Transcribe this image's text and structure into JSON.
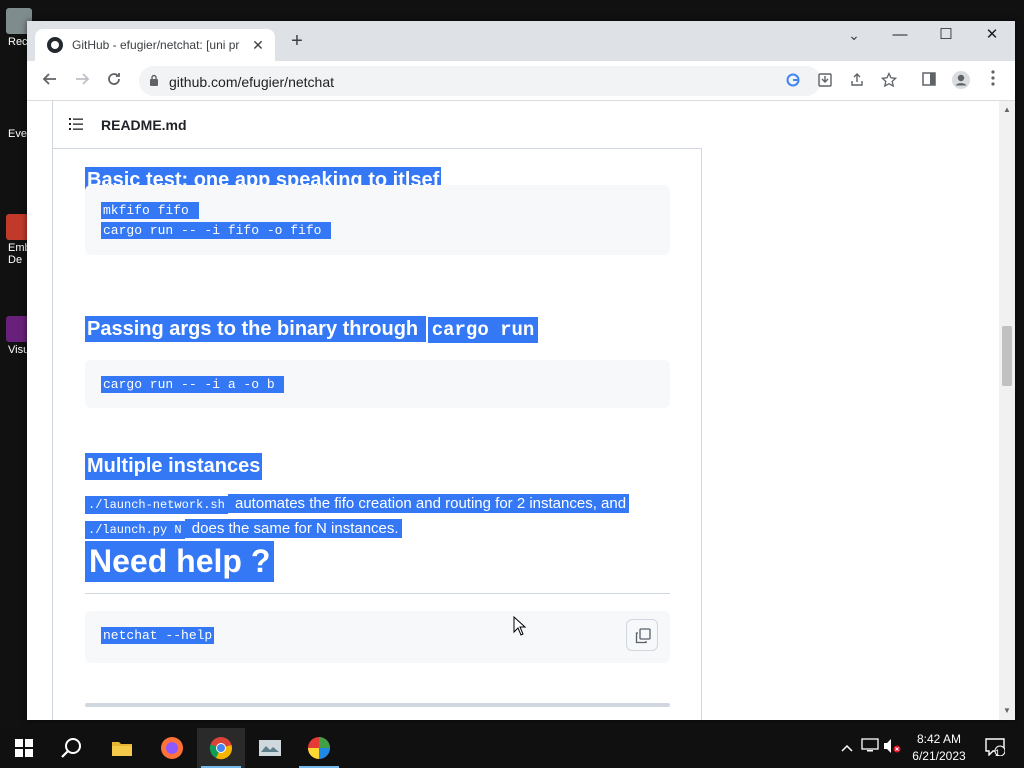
{
  "desktop": {
    "icons": [
      {
        "label": "Rec"
      },
      {
        "label": "Eve"
      },
      {
        "label": "Emb"
      },
      {
        "label": "De"
      },
      {
        "label": "Visu"
      }
    ]
  },
  "browser": {
    "tab": {
      "title": "GitHub - efugier/netchat: [uni pr",
      "close": "✕"
    },
    "new_tab": "+",
    "address": "github.com/efugier/netchat",
    "window_controls": {
      "tab_search": "⌄",
      "minimize": "—",
      "maximize": "☐",
      "close": "✕"
    }
  },
  "readme": {
    "filename": "README.md",
    "sections": {
      "basic_test": {
        "heading": "Basic test: one app speaking to itlsef",
        "code": [
          "mkfifo fifo ",
          "cargo run -- -i fifo -o fifo "
        ]
      },
      "passing_args": {
        "heading": "Passing args to the binary through ",
        "heading_code": "cargo run ",
        "code": [
          "cargo run -- -i a -o b "
        ]
      },
      "multiple": {
        "heading": "Multiple instances ",
        "code1": "./launch-network.sh",
        "text1": " automates the fifo creation and routing for 2 instances, and",
        "code2": "./launch.py N",
        "text2": " does the same for N instances. "
      },
      "need_help": {
        "heading": "Need help ? ",
        "code": [
          "netchat --help"
        ]
      }
    }
  },
  "taskbar": {
    "clock_time": "8:42 AM",
    "clock_date": "6/21/2023",
    "notification_count": "1"
  },
  "colors": {
    "selection": "#3478f6",
    "code_bg": "#f6f8fa",
    "border": "#d0d7de"
  }
}
